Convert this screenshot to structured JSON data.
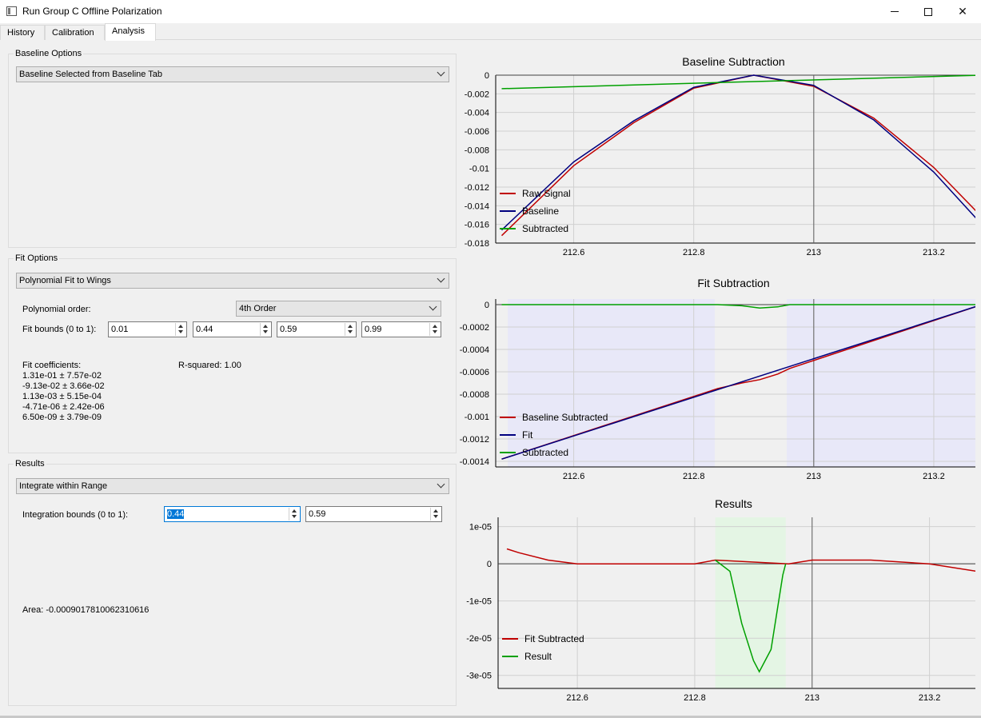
{
  "window": {
    "title": "Run Group C Offline Polarization",
    "minimize_icon": "minimize-icon",
    "maximize_icon": "maximize-icon",
    "close_icon": "close-icon"
  },
  "tabs": [
    {
      "label": "History"
    },
    {
      "label": "Calibration"
    },
    {
      "label": "Analysis",
      "active": true
    }
  ],
  "baseline_options": {
    "title": "Baseline Options",
    "method": "Baseline Selected from Baseline Tab"
  },
  "fit_options": {
    "title": "Fit Options",
    "method": "Polynomial Fit to Wings",
    "order_label": "Polynomial order:",
    "order_value": "4th Order",
    "bounds_label": "Fit bounds (0 to 1):",
    "bounds": [
      "0.01",
      "0.44",
      "0.59",
      "0.99"
    ],
    "coefficients_label": "Fit coefficients:",
    "coefficients": [
      "1.31e-01 ± 7.57e-02",
      "-9.13e-02 ± 3.66e-02",
      "1.13e-03 ± 5.15e-04",
      "-4.71e-06 ± 2.42e-06",
      "6.50e-09 ± 3.79e-09"
    ],
    "r_squared": "R-squared: 1.00"
  },
  "results": {
    "title": "Results",
    "method": "Integrate within Range",
    "bounds_label": "Integration bounds (0 to 1):",
    "bound_low": "0.44",
    "bound_high": "0.59",
    "area": "Area: -0.0009017810062310616"
  },
  "chart_data": [
    {
      "type": "line",
      "title": "Baseline Subtraction",
      "xlim": [
        212.47,
        213.28
      ],
      "ylim": [
        -0.018,
        0
      ],
      "x_ticks": [
        "212.6",
        "212.8",
        "213",
        "213.2"
      ],
      "y_ticks": [
        "0",
        "-0.002",
        "-0.004",
        "-0.006",
        "-0.008",
        "-0.01",
        "-0.012",
        "-0.014",
        "-0.016",
        "-0.018"
      ],
      "grid": true,
      "legend": "bottom-left",
      "series": [
        {
          "name": "Raw Signal",
          "color": "#c00000",
          "x": [
            212.48,
            212.6,
            212.7,
            212.8,
            212.9,
            213.0,
            213.1,
            213.2,
            213.28
          ],
          "y": [
            -0.0172,
            -0.0097,
            -0.0051,
            -0.0014,
            0.0,
            -0.0012,
            -0.0046,
            -0.0099,
            -0.0152
          ]
        },
        {
          "name": "Baseline",
          "color": "#00007f",
          "x": [
            212.48,
            212.6,
            212.7,
            212.8,
            212.9,
            213.0,
            213.1,
            213.2,
            213.28
          ],
          "y": [
            -0.0166,
            -0.0093,
            -0.0049,
            -0.0013,
            0.0,
            -0.0011,
            -0.0048,
            -0.0104,
            -0.016
          ]
        },
        {
          "name": "Subtracted",
          "color": "#00a000",
          "x": [
            212.48,
            213.28
          ],
          "y": [
            -0.00145,
            0.0
          ]
        }
      ]
    },
    {
      "type": "line",
      "title": "Fit Subtraction",
      "xlim": [
        212.47,
        213.28
      ],
      "ylim": [
        -0.00145,
        5e-05
      ],
      "x_ticks": [
        "212.6",
        "212.8",
        "213",
        "213.2"
      ],
      "y_ticks": [
        "0",
        "-0.0002",
        "-0.0004",
        "-0.0006",
        "-0.0008",
        "-0.001",
        "-0.0012",
        "-0.0014"
      ],
      "grid": true,
      "legend": "bottom-left",
      "shaded_x_ranges": [
        [
          212.49,
          212.835
        ],
        [
          212.955,
          213.275
        ]
      ],
      "series": [
        {
          "name": "Baseline Subtracted",
          "color": "#c00000",
          "x": [
            212.48,
            212.84,
            212.88,
            212.91,
            212.94,
            212.96,
            213.28
          ],
          "y": [
            -0.00138,
            -0.00075,
            -0.0007,
            -0.00067,
            -0.00062,
            -0.00057,
            0.0
          ]
        },
        {
          "name": "Fit",
          "color": "#00007f",
          "x": [
            212.48,
            213.28
          ],
          "y": [
            -0.00138,
            0.0
          ]
        },
        {
          "name": "Subtracted",
          "color": "#00a000",
          "x": [
            212.48,
            212.84,
            212.88,
            212.91,
            212.94,
            212.96,
            213.28
          ],
          "y": [
            0.0,
            0.0,
            -1e-05,
            -3e-05,
            -2e-05,
            0.0,
            0.0
          ]
        }
      ]
    },
    {
      "type": "line",
      "title": "Results",
      "xlim": [
        212.465,
        213.285
      ],
      "ylim": [
        -3.35e-05,
        1.25e-05
      ],
      "x_ticks": [
        "212.6",
        "212.8",
        "213",
        "213.2"
      ],
      "y_ticks": [
        "1e-05",
        "0",
        "-1e-05",
        "-2e-05",
        "-3e-05"
      ],
      "grid": true,
      "legend": "bottom-left",
      "shaded_x_ranges": [
        [
          212.835,
          212.955
        ]
      ],
      "series": [
        {
          "name": "Fit Subtracted",
          "color": "#c00000",
          "x": [
            212.48,
            212.5,
            212.55,
            212.6,
            212.7,
            212.8,
            212.835,
            212.96,
            213.0,
            213.1,
            213.2,
            213.28
          ],
          "y": [
            4e-06,
            3e-06,
            1e-06,
            0.0,
            0.0,
            0.0,
            1e-06,
            0.0,
            1e-06,
            1e-06,
            0.0,
            -2e-06
          ]
        },
        {
          "name": "Result",
          "color": "#00a000",
          "x": [
            212.835,
            212.86,
            212.88,
            212.9,
            212.91,
            212.93,
            212.95,
            212.955
          ],
          "y": [
            1e-06,
            -2e-06,
            -1.6e-05,
            -2.6e-05,
            -2.9e-05,
            -2.3e-05,
            -3e-06,
            0.0
          ]
        }
      ]
    }
  ]
}
